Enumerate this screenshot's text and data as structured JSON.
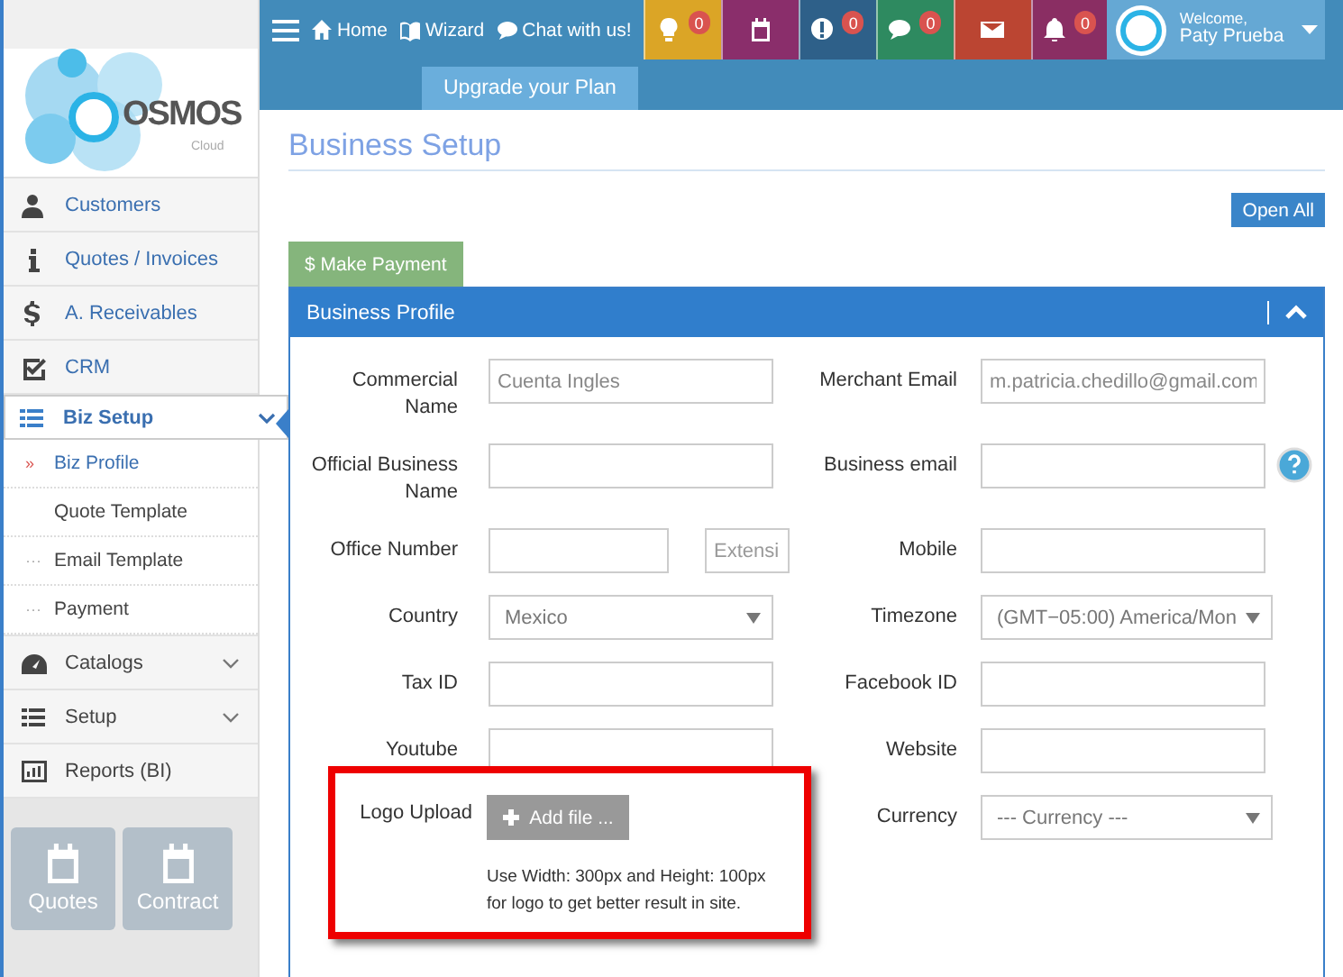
{
  "sidebar": {
    "logo": {
      "word": "OSMOS",
      "sub": "Cloud"
    },
    "items": [
      {
        "label": "Customers",
        "kind": "module",
        "selected": false
      },
      {
        "label": "Quotes / Invoices",
        "kind": "module",
        "selected": false
      },
      {
        "label": "A. Receivables",
        "kind": "module",
        "selected": false
      },
      {
        "label": "CRM",
        "kind": "module",
        "selected": false
      },
      {
        "label": "Biz Setup",
        "kind": "module",
        "selected": true,
        "expanded": true,
        "children": [
          {
            "label": "Biz Profile",
            "marker": "»",
            "selected": true
          },
          {
            "label": "Quote Template",
            "selected": false
          },
          {
            "label": "Email Template",
            "marker": "···",
            "selected": false
          },
          {
            "label": "Payment",
            "marker": "···",
            "selected": false
          }
        ]
      },
      {
        "label": "Catalogs",
        "kind": "admin",
        "selected": false,
        "expanded": false
      },
      {
        "label": "Setup",
        "kind": "admin",
        "selected": false,
        "expanded": false
      },
      {
        "label": "Reports (BI)",
        "kind": "admin",
        "selected": false
      }
    ],
    "tiles": [
      {
        "label": "Quotes"
      },
      {
        "label": "Contract"
      }
    ]
  },
  "topbar": {
    "links": [
      {
        "label": "Home"
      },
      {
        "label": "Wizard"
      },
      {
        "label": "Chat with us!"
      }
    ],
    "notifications": [
      {
        "color": "#dba526",
        "count": "0"
      },
      {
        "color": "#8a2e6b"
      },
      {
        "color": "#2e6089",
        "count": "0"
      },
      {
        "color": "#2e8a60",
        "count": "0"
      },
      {
        "color": "#bb4532"
      },
      {
        "color": "#8a2e63",
        "count": "0"
      }
    ],
    "user": {
      "greeting": "Welcome,",
      "name": "Paty Prueba"
    },
    "upgrade_tab": "Upgrade your Plan"
  },
  "page": {
    "title": "Business Setup",
    "open_all_button": "Open All",
    "payment_button": "$ Make Payment"
  },
  "panel": {
    "title": "Business Profile",
    "expanded": true,
    "rows": [
      {
        "left": {
          "label": "Commercial Name",
          "kind": "text",
          "value": "Cuenta Ingles"
        },
        "right": {
          "label": "Merchant Email",
          "kind": "text",
          "value": "m.patricia.chedillo@gmail.com"
        }
      },
      {
        "left": {
          "label": "Official Business Name",
          "kind": "text"
        },
        "right": {
          "label": "Business email",
          "kind": "text",
          "help": true
        }
      },
      {
        "left": {
          "label": "Office Number",
          "kind": "phone",
          "extension_placeholder": "Extensi"
        },
        "right": {
          "label": "Mobile",
          "kind": "text"
        }
      },
      {
        "left": {
          "label": "Country",
          "kind": "select",
          "value": "Mexico"
        },
        "right": {
          "label": "Timezone",
          "kind": "select",
          "value": "(GMT−05:00) America/Mon"
        }
      },
      {
        "left": {
          "label": "Tax ID",
          "kind": "text"
        },
        "right": {
          "label": "Facebook ID",
          "kind": "text"
        }
      },
      {
        "left": {
          "label": "Youtube",
          "kind": "text"
        },
        "right": {
          "label": "Website",
          "kind": "text"
        }
      },
      {
        "left": {
          "label": "Logo Upload",
          "kind": "file",
          "button": "Add file ...",
          "hint": "Use Width: 300px and Height: 100px for logo to get better result in site.",
          "highlighted": true
        },
        "right": {
          "label": "Currency",
          "kind": "select",
          "value": "--- Currency ---"
        }
      }
    ]
  }
}
